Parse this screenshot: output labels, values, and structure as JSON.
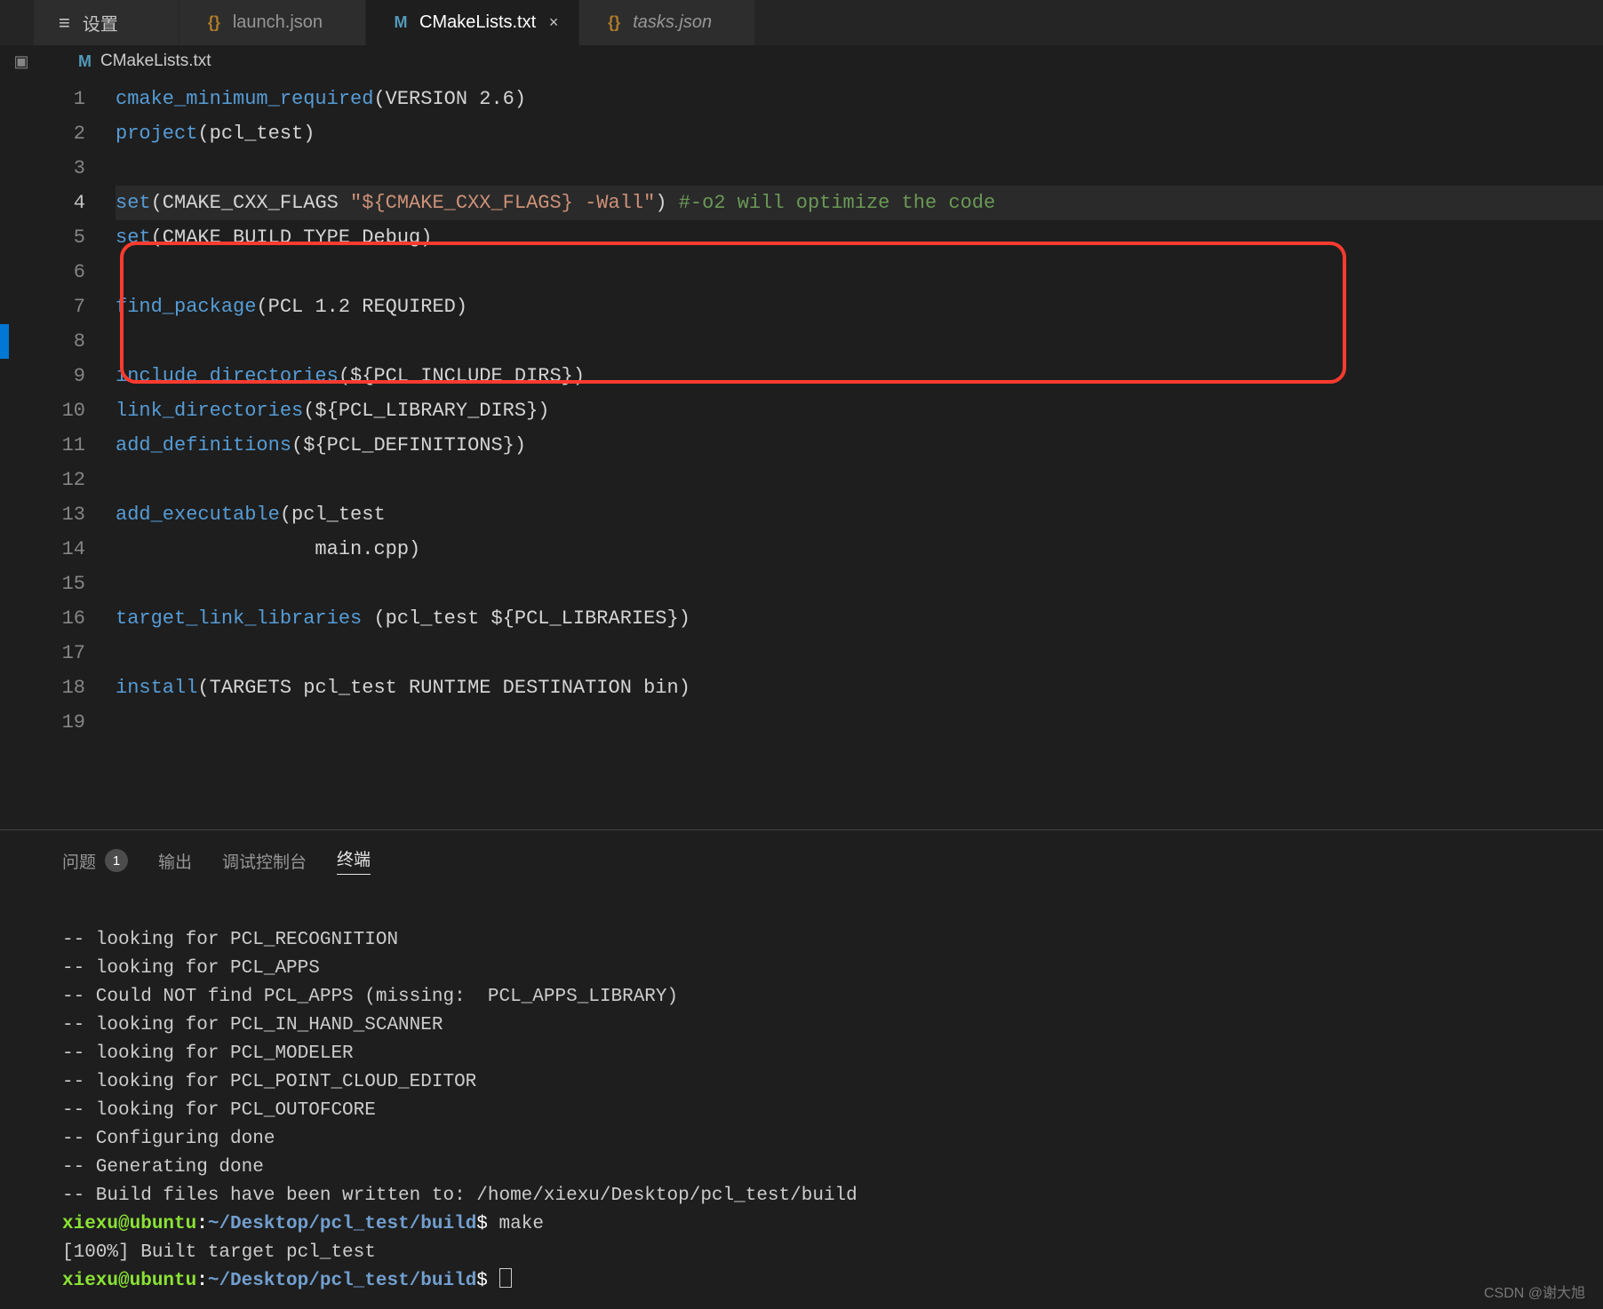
{
  "tabs": {
    "settings": {
      "label": "设置"
    },
    "launch": {
      "label": "launch.json"
    },
    "cmake": {
      "label": "CMakeLists.txt"
    },
    "tasks": {
      "label": "tasks.json"
    }
  },
  "breadcrumb": {
    "file": "CMakeLists.txt"
  },
  "editor": {
    "line_numbers": [
      "1",
      "2",
      "3",
      "4",
      "5",
      "6",
      "7",
      "8",
      "9",
      "10",
      "11",
      "12",
      "13",
      "14",
      "15",
      "16",
      "17",
      "18",
      "19"
    ],
    "current_line_index": 3,
    "lines": {
      "l1_fn": "cmake_minimum_required",
      "l1_rest": "(VERSION 2.6)",
      "l2_fn": "project",
      "l2_rest": "(pcl_test)",
      "l4_fn": "set",
      "l4_open": "(CMAKE_CXX_FLAGS ",
      "l4_str": "\"${CMAKE_CXX_FLAGS} -Wall\"",
      "l4_close": ")",
      "l4_comment": " #-o2 will optimize the code",
      "l5_fn": "set",
      "l5_rest": "(CMAKE_BUILD_TYPE Debug)",
      "l7_fn": "find_package",
      "l7_rest": "(PCL 1.2 REQUIRED)",
      "l9_fn": "include_directories",
      "l9_rest": "(${PCL_INCLUDE_DIRS})",
      "l10_fn": "link_directories",
      "l10_rest": "(${PCL_LIBRARY_DIRS})",
      "l11_fn": "add_definitions",
      "l11_rest": "(${PCL_DEFINITIONS})",
      "l13_fn": "add_executable",
      "l13_rest": "(pcl_test",
      "l14_rest": "                 main.cpp)",
      "l16_fn": "target_link_libraries",
      "l16_rest": " (pcl_test ${PCL_LIBRARIES})",
      "l18_fn": "install",
      "l18_rest": "(TARGETS pcl_test RUNTIME DESTINATION bin)"
    }
  },
  "panel": {
    "problems": {
      "label": "问题",
      "count": "1"
    },
    "output": {
      "label": "输出"
    },
    "debug": {
      "label": "调试控制台"
    },
    "terminal": {
      "label": "终端"
    }
  },
  "terminal": {
    "lines": [
      "-- looking for PCL_RECOGNITION",
      "-- looking for PCL_APPS",
      "-- Could NOT find PCL_APPS (missing:  PCL_APPS_LIBRARY)",
      "-- looking for PCL_IN_HAND_SCANNER",
      "-- looking for PCL_MODELER",
      "-- looking for PCL_POINT_CLOUD_EDITOR",
      "-- looking for PCL_OUTOFCORE",
      "-- Configuring done",
      "-- Generating done",
      "-- Build files have been written to: /home/xiexu/Desktop/pcl_test/build"
    ],
    "prompt_user": "xiexu@ubuntu",
    "prompt_colon": ":",
    "prompt_path": "~/Desktop/pcl_test/build",
    "prompt_dollar": "$",
    "cmd1": " make",
    "build_line": "[100%] Built target pcl_test"
  },
  "watermark": "CSDN @谢大旭"
}
